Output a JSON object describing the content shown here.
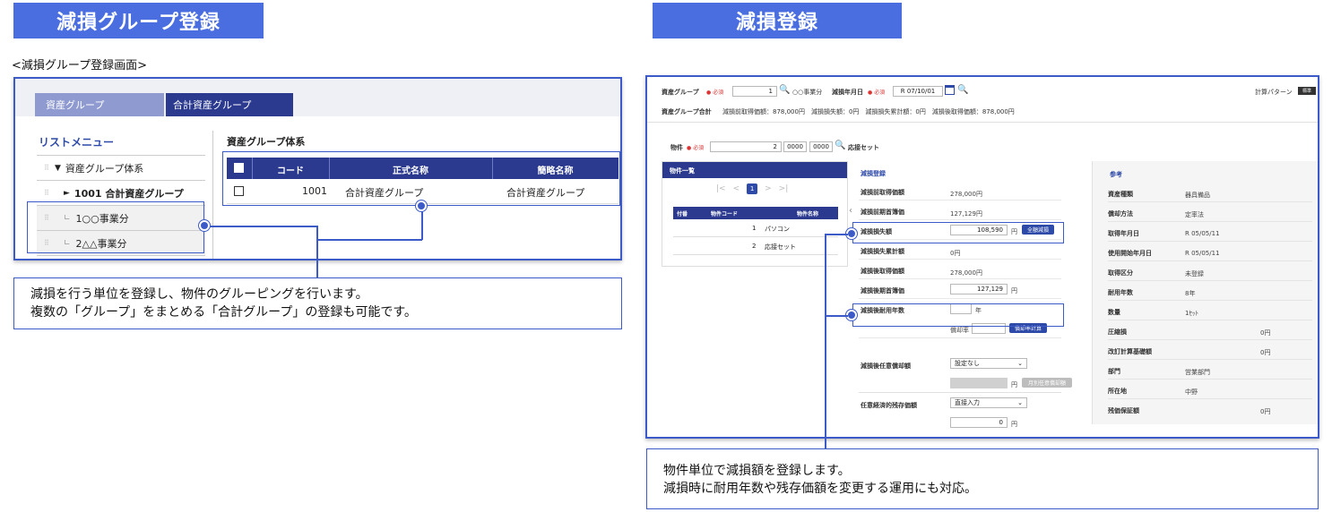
{
  "left": {
    "banner": "減損グループ登録",
    "caption": "<減損グループ登録画面>",
    "tabs": [
      "資産グループ",
      "合計資産グループ"
    ],
    "list_menu_title": "リストメニュー",
    "tree": [
      {
        "toggle": "▼",
        "label": "資産グループ体系"
      },
      {
        "toggle": "►",
        "label": "1001 合計資産グループ"
      },
      {
        "toggle": "∟",
        "label": "1○○事業分"
      },
      {
        "toggle": "∟",
        "label": "2△△事業分"
      }
    ],
    "panel_title": "資産グループ体系",
    "table": {
      "headers": [
        "コード",
        "正式名称",
        "簡略名称"
      ],
      "rows": [
        {
          "code": "1001",
          "name": "合計資産グループ",
          "short": "合計資産グループ"
        }
      ]
    },
    "description": [
      "減損を行う単位を登録し、物件のグルーピングを行います。",
      "複数の「グループ」をまとめる「合計グループ」の登録も可能です。"
    ]
  },
  "right": {
    "banner": "減損登録",
    "top": {
      "group_label": "資産グループ",
      "required": "必須",
      "group_value": "1",
      "group_name": "○○事業分",
      "date_label": "減損年月日",
      "date_value": "R 07/10/01",
      "calc_pattern": "計算パターン",
      "calc_badge": "標準",
      "total_label": "資産グループ合計",
      "totals": "減損前取得価額：878,000円　減損損失額：0円　減損損失累計額：0円　減損後取得価額：878,000円"
    },
    "property": {
      "label": "物件",
      "required": "必須",
      "value": "2",
      "code1": "0000",
      "code2": "0000",
      "name": "応接セット"
    },
    "list": {
      "title": "物件一覧",
      "page": "1",
      "headers": [
        "付番",
        "物件コード",
        "物件名称"
      ],
      "rows": [
        {
          "no": "1",
          "name": "パソコン"
        },
        {
          "no": "2",
          "name": "応接セット"
        }
      ]
    },
    "form": {
      "title": "減損登録",
      "fields": [
        {
          "label": "減損前取得価額",
          "value": "278,000円"
        },
        {
          "label": "減損前期首簿価",
          "value": "127,129円"
        },
        {
          "label": "減損損失額",
          "value": "108,590",
          "unit": "円",
          "button": "全額減損"
        },
        {
          "label": "減損損失累計額",
          "value": "0円"
        },
        {
          "label": "減損後取得価額",
          "value": "278,000円"
        },
        {
          "label": "減損後期首簿価",
          "value": "127,129",
          "unit": "円"
        },
        {
          "label": "減損後耐用年数",
          "value": "",
          "unit": "年"
        }
      ],
      "rate_label": "償却率",
      "rate_button": "償却率計算",
      "dep_label": "減損後任意償却額",
      "dep_select": "設定なし",
      "dep_unit": "円",
      "dep_button": "月別任意償却額",
      "residual_label": "任意経済的残存価額",
      "residual_select": "直接入力",
      "residual_value": "0",
      "residual_unit": "円"
    },
    "reference": {
      "title": "参考",
      "rows": [
        {
          "label": "資産種類",
          "value": "器具備品"
        },
        {
          "label": "償却方法",
          "value": "定率法"
        },
        {
          "label": "取得年月日",
          "value": "R 05/05/11"
        },
        {
          "label": "使用開始年月日",
          "value": "R 05/05/11"
        },
        {
          "label": "取得区分",
          "value": "未登録"
        },
        {
          "label": "耐用年数",
          "value": "8年"
        },
        {
          "label": "数量",
          "value": "1ｾｯﾄ"
        },
        {
          "label": "圧縮損",
          "value": "0円"
        },
        {
          "label": "改訂計算基礎額",
          "value": "0円"
        },
        {
          "label": "部門",
          "value": "営業部門"
        },
        {
          "label": "所在地",
          "value": "中野"
        },
        {
          "label": "残価保証額",
          "value": "0円"
        }
      ]
    },
    "description": [
      "物件単位で減損額を登録します。",
      "減損時に耐用年数や残存価額を変更する運用にも対応。"
    ]
  }
}
